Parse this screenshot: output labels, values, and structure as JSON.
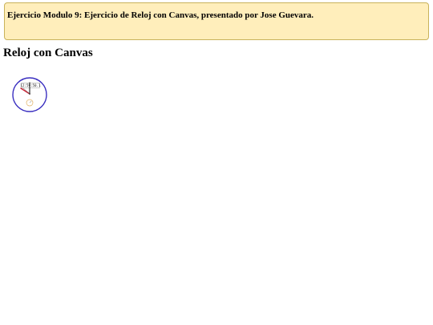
{
  "banner": {
    "text": "Ejercicio Modulo 9: Ejercicio de Reloj con Canvas, presentado por Jose Guevara."
  },
  "page": {
    "title": "Reloj con Canvas"
  },
  "clock": {
    "digital_time": "12:59:50.1",
    "face_color": "#ffffff",
    "border_color": "#3a2fc0",
    "hour_hand_color": "#cc2233",
    "seconds_dial_color": "#e0b060",
    "icons": {
      "hands": "clock-hands-icon",
      "stopwatch": "seconds-dial-icon"
    }
  },
  "colors": {
    "banner_background": "#ffeebb",
    "banner_border": "#c9b25b",
    "text": "#000000"
  }
}
